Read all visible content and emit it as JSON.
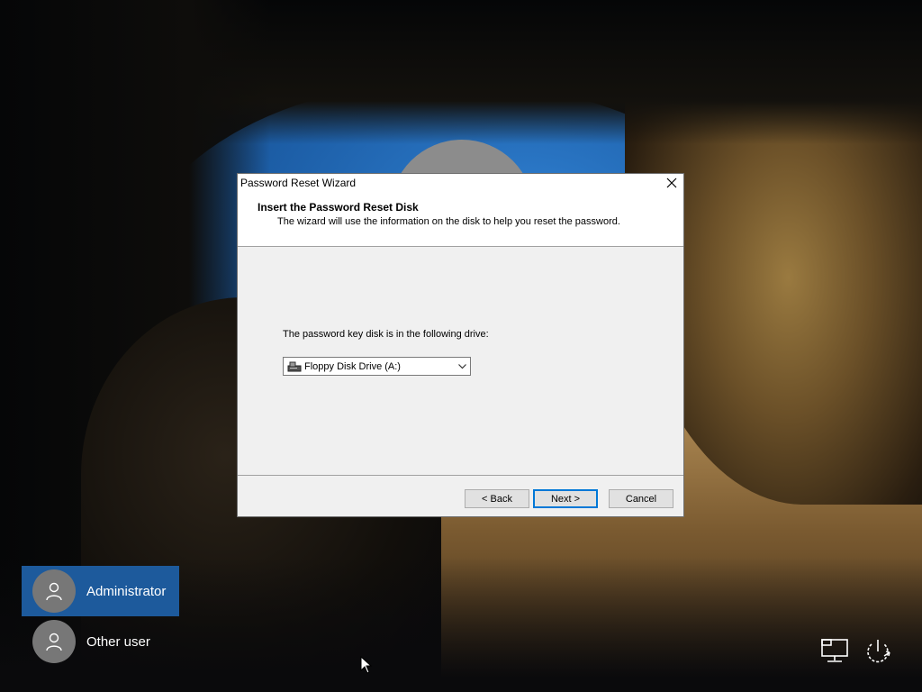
{
  "dialog": {
    "title": "Password Reset Wizard",
    "header_title": "Insert the Password Reset Disk",
    "header_subtitle": "The wizard will use the information on the disk to help you reset the password.",
    "drive_label": "The password key disk is in the following drive:",
    "drive_selected": "Floppy Disk Drive (A:)",
    "buttons": {
      "back": "< Back",
      "next": "Next >",
      "cancel": "Cancel"
    },
    "focused_button_color": "#0078d7"
  },
  "users": [
    {
      "name": "Administrator",
      "selected": true
    },
    {
      "name": "Other user",
      "selected": false
    }
  ],
  "system_tray": {
    "icons": [
      "network-icon",
      "ease-of-access-icon",
      "power-icon"
    ]
  },
  "colors": {
    "selected_user_tile": "#1d5a9c"
  }
}
